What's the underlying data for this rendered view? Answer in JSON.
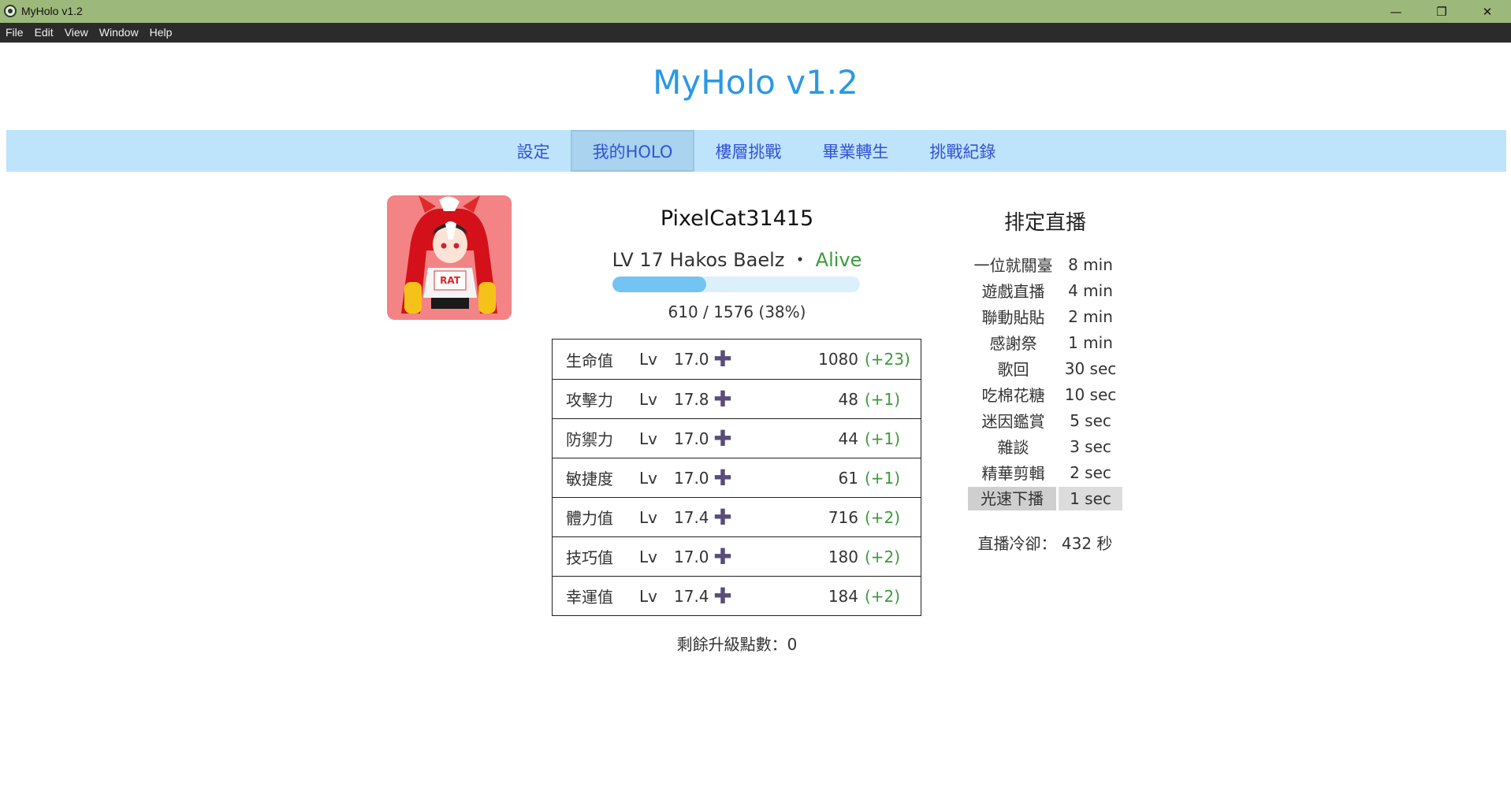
{
  "window": {
    "title": "MyHolo v1.2",
    "controls": {
      "minimize": "—",
      "maximize": "❐",
      "close": "✕"
    }
  },
  "menu": [
    "File",
    "Edit",
    "View",
    "Window",
    "Help"
  ],
  "header": {
    "title": "MyHolo v1.2"
  },
  "nav": {
    "items": [
      "設定",
      "我的HOLO",
      "樓層挑戰",
      "畢業轉生",
      "挑戰紀錄"
    ],
    "active": "我的HOLO"
  },
  "profile": {
    "name": "PixelCat31415",
    "level_line": "LV 17 Hakos Baelz",
    "separator": "・",
    "status": "Alive",
    "xp_current": 610,
    "xp_max": 1576,
    "xp_fraction": 0.38,
    "xp_text": "610 / 1576 (38%)"
  },
  "stats": [
    {
      "name": "生命值",
      "lv_label": "Lv",
      "lv": "17.0",
      "value": "1080",
      "bonus": "(+23)"
    },
    {
      "name": "攻擊力",
      "lv_label": "Lv",
      "lv": "17.8",
      "value": "48",
      "bonus": "(+1)"
    },
    {
      "name": "防禦力",
      "lv_label": "Lv",
      "lv": "17.0",
      "value": "44",
      "bonus": "(+1)"
    },
    {
      "name": "敏捷度",
      "lv_label": "Lv",
      "lv": "17.0",
      "value": "61",
      "bonus": "(+1)"
    },
    {
      "name": "體力值",
      "lv_label": "Lv",
      "lv": "17.4",
      "value": "716",
      "bonus": "(+2)"
    },
    {
      "name": "技巧值",
      "lv_label": "Lv",
      "lv": "17.0",
      "value": "180",
      "bonus": "(+2)"
    },
    {
      "name": "幸運值",
      "lv_label": "Lv",
      "lv": "17.4",
      "value": "184",
      "bonus": "(+2)"
    }
  ],
  "points": "剩餘升級點數：0",
  "schedule": {
    "title": "排定直播",
    "items": [
      {
        "name": "一位就關臺",
        "time": "8 min"
      },
      {
        "name": "遊戲直播",
        "time": "4 min"
      },
      {
        "name": "聯動貼貼",
        "time": "2 min"
      },
      {
        "name": "感謝祭",
        "time": "1 min"
      },
      {
        "name": "歌回",
        "time": "30 sec"
      },
      {
        "name": "吃棉花糖",
        "time": "10 sec"
      },
      {
        "name": "迷因鑑賞",
        "time": "5 sec"
      },
      {
        "name": "雜談",
        "time": "3 sec"
      },
      {
        "name": "精華剪輯",
        "time": "2 sec"
      },
      {
        "name": "光速下播",
        "time": "1 sec"
      }
    ],
    "selected": "光速下播",
    "cooldown": "直播冷卻： 432 秒"
  },
  "colors": {
    "titlebar": "#9db87b",
    "menubar": "#2b2b2b",
    "header": "#2a98e6",
    "nav_bg": "#bde4fb",
    "nav_text": "#3552d6",
    "xp_fill": "#73c3f3",
    "bonus": "#3b9a3b"
  },
  "icons": {
    "app": "app-icon",
    "plus": "plus-icon"
  }
}
